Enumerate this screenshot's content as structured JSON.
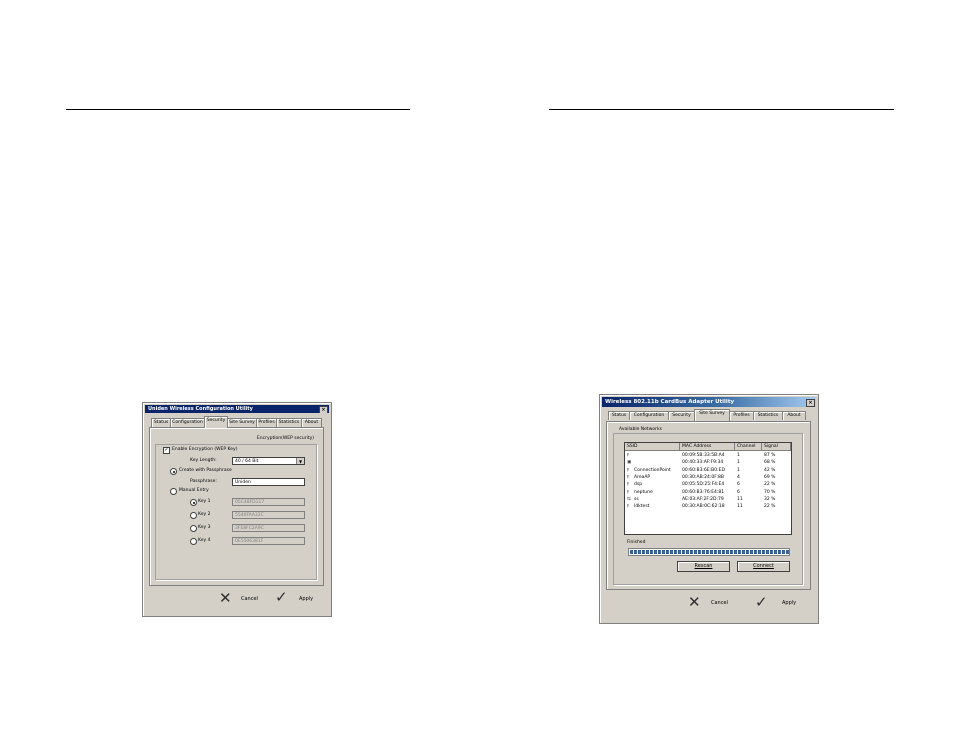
{
  "left_window": {
    "title": "Uniden Wireless Configuration Utility",
    "close_glyph": "×",
    "tabs": [
      "Status",
      "Configuration",
      "Security",
      "Site Survey",
      "Profiles",
      "Statistics",
      "About"
    ],
    "active_tab": "Security",
    "group_label": "Encryption(WEP security)",
    "enable_encryption": {
      "label": "Enable Encryption (WEP Key)",
      "checked": true
    },
    "key_length": {
      "label": "Key Length:",
      "value": "40 / 64 Bit"
    },
    "create_passphrase": {
      "label": "Create with Passphrase",
      "selected": true
    },
    "passphrase": {
      "label": "Passphrase:",
      "value": "Uniden"
    },
    "manual_entry": {
      "label": "Manual Entry",
      "selected": false
    },
    "keys": [
      {
        "label": "Key 1",
        "value": "05C48FD117",
        "selected": true
      },
      {
        "label": "Key 2",
        "value": "5540FAA32C",
        "selected": false
      },
      {
        "label": "Key 3",
        "value": "3FE8FC2A9C",
        "selected": false
      },
      {
        "label": "Key 4",
        "value": "0E5506381F",
        "selected": false
      }
    ],
    "cancel_label": "Cancel",
    "apply_label": "Apply",
    "cancel_icon": "x-icon",
    "apply_icon": "check-icon"
  },
  "right_window": {
    "title": "Wireless 802.11b CardBus Adapter Utility",
    "close_glyph": "×",
    "tabs": [
      "Status",
      "Configuration",
      "Security",
      "Site Survey",
      "Profiles",
      "Statistics",
      "About"
    ],
    "active_tab": "Site Survey",
    "group_label": "Available Networks",
    "columns": [
      "SSID",
      "MAC Address",
      "Channel",
      "Signal"
    ],
    "networks": [
      {
        "icon": "antenna-icon",
        "ssid": "",
        "mac": "00:09:5B:33:5B:A4",
        "channel": "1",
        "signal": "87 %"
      },
      {
        "icon": "computer-icon",
        "ssid": "",
        "mac": "00:40:33:AF:F9:34",
        "channel": "1",
        "signal": "68 %"
      },
      {
        "icon": "antenna-icon",
        "ssid": "ConnectionPoint",
        "mac": "00:60:B3:6E:B0:ED",
        "channel": "1",
        "signal": "42 %"
      },
      {
        "icon": "antenna-icon",
        "ssid": "AreaAP",
        "mac": "00:30:AB:24:0F:8B",
        "channel": "4",
        "signal": "69 %"
      },
      {
        "icon": "antenna-icon",
        "ssid": "dsp",
        "mac": "00:05:5D:25:F4:E4",
        "channel": "6",
        "signal": "22 %"
      },
      {
        "icon": "antenna-icon",
        "ssid": "neptune",
        "mac": "00:60:B3:76:E4:81",
        "channel": "6",
        "signal": "70 %"
      },
      {
        "icon": "adhoc-icon",
        "ssid": "ss",
        "mac": "AE:03:AF:2F:2D:79",
        "channel": "11",
        "signal": "32 %"
      },
      {
        "icon": "antenna-icon",
        "ssid": "Idktest",
        "mac": "00:30:AB:0C:62:18",
        "channel": "11",
        "signal": "22 %"
      }
    ],
    "status_label": "Finished",
    "scan_progress_fraction": 1.0,
    "rescan_label": "Rescan",
    "connect_label": "Connect",
    "cancel_label": "Cancel",
    "apply_label": "Apply",
    "cancel_icon": "x-icon",
    "apply_icon": "check-icon"
  }
}
